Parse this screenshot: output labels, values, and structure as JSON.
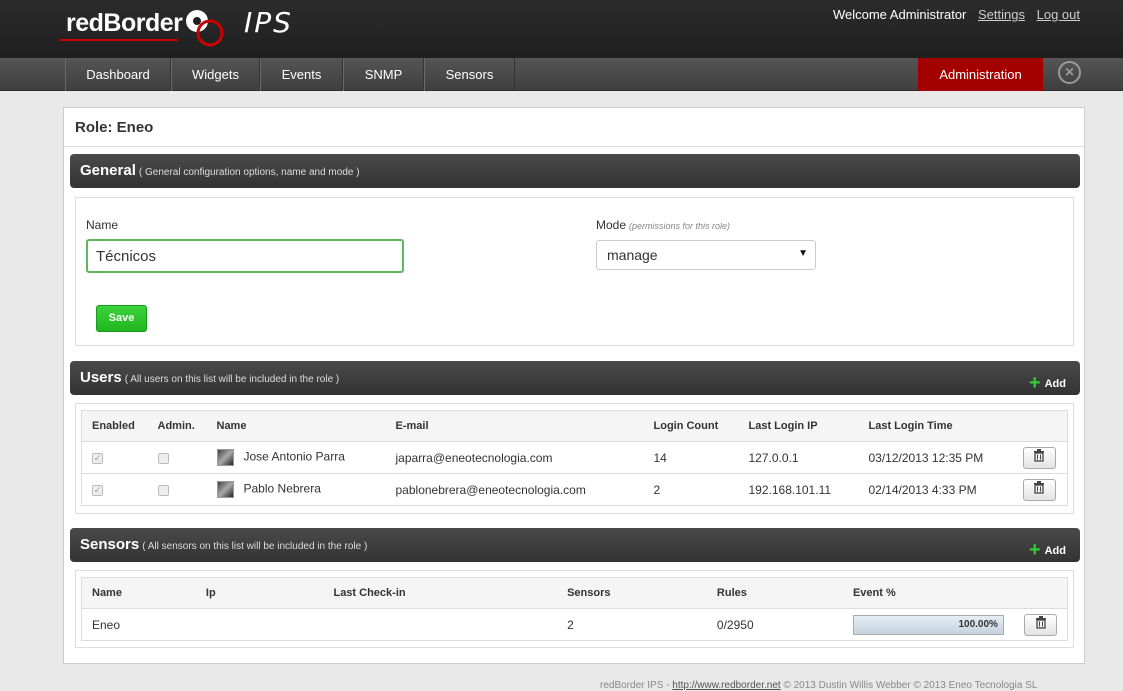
{
  "header": {
    "logo_text": "redBorder",
    "product": "IPS",
    "welcome": "Welcome Administrator",
    "settings_label": "Settings",
    "logout_label": "Log out"
  },
  "nav": {
    "items": [
      "Dashboard",
      "Widgets",
      "Events",
      "SNMP",
      "Sensors"
    ],
    "admin_label": "Administration",
    "close_icon": "circle-close-icon"
  },
  "page": {
    "title": "Role: Eneo"
  },
  "general": {
    "title": "General",
    "subtitle": "( General configuration options, name and mode )",
    "name_label": "Name",
    "name_value": "Técnicos",
    "mode_label": "Mode",
    "mode_hint": "(permissions for this role)",
    "mode_value": "manage",
    "save_label": "Save"
  },
  "users": {
    "title": "Users",
    "subtitle": "( All users on this list will be included in the role )",
    "add_label": "Add",
    "columns": [
      "Enabled",
      "Admin.",
      "Name",
      "E-mail",
      "Login Count",
      "Last Login IP",
      "Last Login Time"
    ],
    "rows": [
      {
        "enabled": true,
        "admin": false,
        "name": "Jose Antonio Parra",
        "email": "japarra@eneotecnologia.com",
        "login_count": "14",
        "last_ip": "127.0.0.1",
        "last_time": "03/12/2013 12:35 PM"
      },
      {
        "enabled": true,
        "admin": false,
        "name": "Pablo Nebrera",
        "email": "pablonebrera@eneotecnologia.com",
        "login_count": "2",
        "last_ip": "192.168.101.11",
        "last_time": "02/14/2013 4:33 PM"
      }
    ]
  },
  "sensors": {
    "title": "Sensors",
    "subtitle": "( All sensors on this list will be included in the role )",
    "add_label": "Add",
    "columns": [
      "Name",
      "Ip",
      "Last Check-in",
      "Sensors",
      "Rules",
      "Event %"
    ],
    "rows": [
      {
        "name": "Eneo",
        "ip": "",
        "last_checkin": "",
        "sensors": "2",
        "rules": "0/2950",
        "event_pct": "100.00%",
        "event_fraction": 1.0
      }
    ]
  },
  "footer": {
    "product": "redBorder IPS",
    "sep": " - ",
    "url": "http://www.redborder.net",
    "copyright": " © 2013 Dustin Willis Webber © 2013 Eneo Tecnologia SL"
  },
  "colors": {
    "accent_red": "#a30000",
    "save_green": "#1fb61f",
    "add_plus_green": "#33cc33"
  }
}
